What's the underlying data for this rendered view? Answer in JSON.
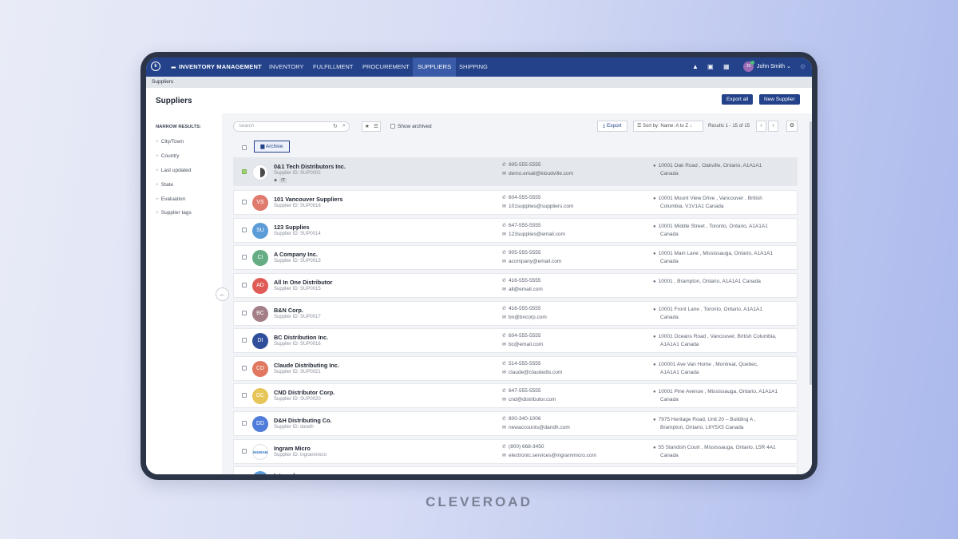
{
  "nav": {
    "logo_text": "k",
    "app_title": "INVENTORY MANAGEMENT",
    "tabs": [
      {
        "label": "INVENTORY"
      },
      {
        "label": "FULFILLMENT"
      },
      {
        "label": "PROCUREMENT"
      },
      {
        "label": "SUPPLIERS",
        "active": true
      },
      {
        "label": "SHIPPING"
      }
    ],
    "user_initials": "JS",
    "user_name": "John Smith ⌄"
  },
  "breadcrumb": "Suppliers",
  "page": {
    "title": "Suppliers",
    "export_all": "Export all",
    "new_supplier": "New Supplier"
  },
  "sidebar": {
    "title": "NARROW RESULTS:",
    "filters": [
      "City/Town",
      "Country",
      "Last updated",
      "State",
      "Evaluation",
      "Supplier tags"
    ]
  },
  "toolbar": {
    "search_placeholder": "Search",
    "show_archived": "Show archived",
    "export": "Export",
    "sort_label": "Sort by: Name: A to Z",
    "results": "Results 1 - 15 of 15",
    "archive": "Archive"
  },
  "suppliers": [
    {
      "initials": "",
      "color": "#ffffff",
      "name": "0&1 Tech Distributors Inc.",
      "id": "Supplier ID: SUP0002",
      "phone": "905-555-5555",
      "email": "demo.email@kloudville.com",
      "address1": "10001 Oak Road , Oakville, Ontario, A1A1A1",
      "address2": "Canada",
      "selected": true,
      "tag": "IT"
    },
    {
      "initials": "VS",
      "color": "#e07a6e",
      "name": "101 Vancouver Suppliers",
      "id": "Supplier ID: SUP0018",
      "phone": "604-555-5555",
      "email": "101supplies@suppliers.com",
      "address1": "10001 Mount View Drive , Vancouver , British",
      "address2": "Columbia, V1V1A1 Canada"
    },
    {
      "initials": "SU",
      "color": "#5b9bd8",
      "name": "123 Supplies",
      "id": "Supplier ID: SUP0014",
      "phone": "647-555-5555",
      "email": "123supplies@email.com",
      "address1": "10001 Middle Street , Toronto, Ontario, A1A1A1",
      "address2": "Canada"
    },
    {
      "initials": "CI",
      "color": "#66ad84",
      "name": "A Company Inc.",
      "id": "Supplier ID: SUP0013",
      "phone": "905-555-5555",
      "email": "acompany@email.com",
      "address1": "10001 Main Lane , Mississauga, Ontario, A1A1A1",
      "address2": "Canada"
    },
    {
      "initials": "AD",
      "color": "#e05b55",
      "name": "All In One Distributor",
      "id": "Supplier ID: SUP0015",
      "phone": "416-555-5555",
      "email": "all@email.com",
      "address1": "10001 , Brampton, Ontario, A1A1A1 Canada",
      "address2": ""
    },
    {
      "initials": "BC",
      "color": "#a37e86",
      "name": "B&N Corp.",
      "id": "Supplier ID: SUP0017",
      "phone": "416-555-5555",
      "email": "bn@bncorp.com",
      "address1": "10001 Front Lane , Toronto, Ontario, A1A1A1",
      "address2": "Canada"
    },
    {
      "initials": "DI",
      "color": "#2f4f9a",
      "name": "BC Distribution Inc.",
      "id": "Supplier ID: SUP0016",
      "phone": "604-555-5555",
      "email": "bc@email.com",
      "address1": "10001 Oceans Road , Vancouver, British Columbia,",
      "address2": "A1A1A1 Canada"
    },
    {
      "initials": "CD",
      "color": "#e0775e",
      "name": "Claude Distributing Inc.",
      "id": "Supplier ID: SUP0021",
      "phone": "514-555-5555",
      "email": "claude@claudedis.com",
      "address1": "100001 Ave Van Home , Montreal, Quebec,",
      "address2": "A1A1A1 Canada"
    },
    {
      "initials": "DC",
      "color": "#e8c558",
      "name": "CND Distributor Corp.",
      "id": "Supplier ID: SUP0020",
      "phone": "647-555-5555",
      "email": "cnd@distributor.com",
      "address1": "10001 Pine Avenue , Mississauga, Ontario, A1A1A1",
      "address2": "Canada"
    },
    {
      "initials": "DD",
      "color": "#4f7bd9",
      "name": "D&H Distributing Co.",
      "id": "Supplier ID: dandh",
      "phone": "800-340-1006",
      "email": "newaccounts@dandh.com",
      "address1": "7975 Heritage Road, Unit 20 – Building A ,",
      "address2": "Brampton, Ontario, L6Y5X5 Canada"
    },
    {
      "initials": "INGRAM",
      "color": "#ffffff",
      "name": "Ingram Micro",
      "id": "Supplier ID: ingrammicro",
      "phone": "(800) 668-3450",
      "email": "electronic.services@ingrammicro.com",
      "address1": "55 Standish Court , Mississauga, Ontario, L5R 4A1",
      "address2": "Canada"
    },
    {
      "initials": "",
      "color": "#5b9bd8",
      "name": "Internal",
      "id": "",
      "phone": "",
      "email": "",
      "address1": "",
      "address2": ""
    }
  ],
  "brand": "CLEVEROAD"
}
